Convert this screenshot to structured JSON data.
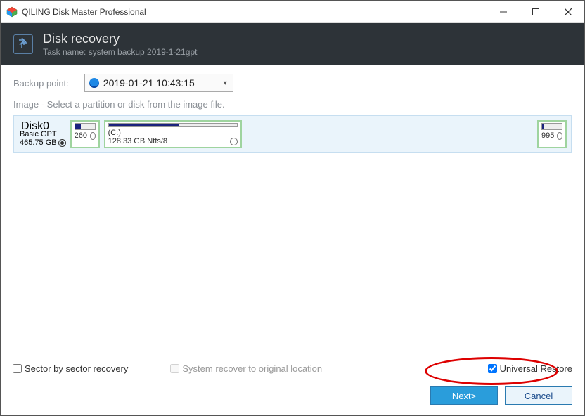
{
  "window": {
    "title": "QILING Disk Master Professional"
  },
  "header": {
    "title": "Disk recovery",
    "subtitle": "Task name: system backup 2019-1-21gpt"
  },
  "backup_point": {
    "label": "Backup point:",
    "selected": "2019-01-21 10:43:15"
  },
  "instruction": "Image - Select a partition or disk from the image file.",
  "disk": {
    "name": "Disk0",
    "type": "Basic GPT",
    "size": "465.75 GB",
    "partitions": [
      {
        "label": "",
        "size_label": "260",
        "fill_pct": 30
      },
      {
        "label": "(C:)",
        "size_label": "128.33 GB Ntfs/8",
        "fill_pct": 55
      },
      {
        "label": "",
        "size_label": "995",
        "fill_pct": 10
      }
    ]
  },
  "options": {
    "sector_by_sector": {
      "label": "Sector by sector recovery",
      "checked": false
    },
    "system_recover_original": {
      "label": "System recover to original location",
      "checked": false,
      "enabled": false
    },
    "universal_restore": {
      "label": "Universal Restore",
      "checked": true
    }
  },
  "buttons": {
    "next": "Next>",
    "cancel": "Cancel"
  }
}
